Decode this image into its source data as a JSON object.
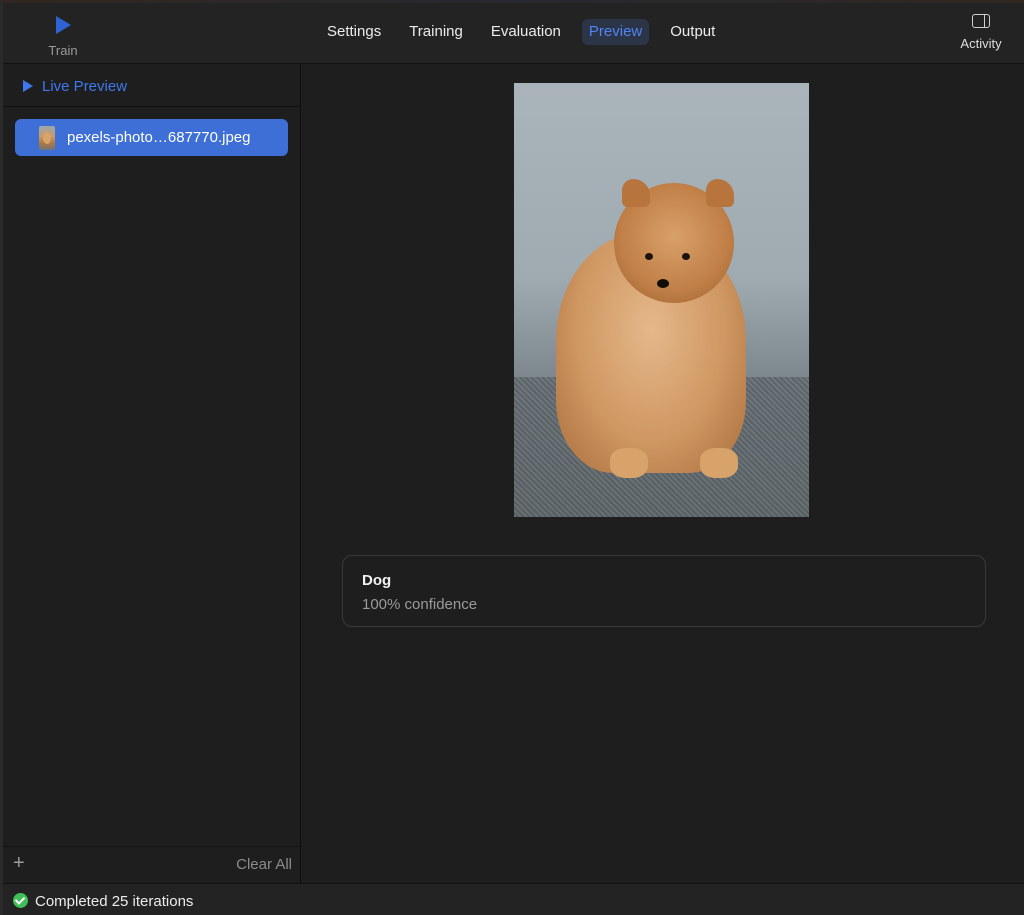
{
  "toolbar": {
    "train_label": "Train",
    "activity_label": "Activity",
    "tabs": [
      {
        "label": "Settings",
        "active": false
      },
      {
        "label": "Training",
        "active": false
      },
      {
        "label": "Evaluation",
        "active": false
      },
      {
        "label": "Preview",
        "active": true
      },
      {
        "label": "Output",
        "active": false
      }
    ]
  },
  "sidebar": {
    "live_preview_label": "Live Preview",
    "files": [
      {
        "name": "pexels-photo…687770.jpeg",
        "selected": true
      }
    ],
    "add_icon": "plus-icon",
    "clear_all_label": "Clear All"
  },
  "main": {
    "result": {
      "label": "Dog",
      "confidence": "100% confidence"
    }
  },
  "status": {
    "icon": "checkmark-circle-icon",
    "text": "Completed 25 iterations"
  },
  "colors": {
    "accent": "#3d78ec",
    "selected_row": "#3d6fd6",
    "success": "#3fbf57",
    "background": "#1e1e1e"
  }
}
